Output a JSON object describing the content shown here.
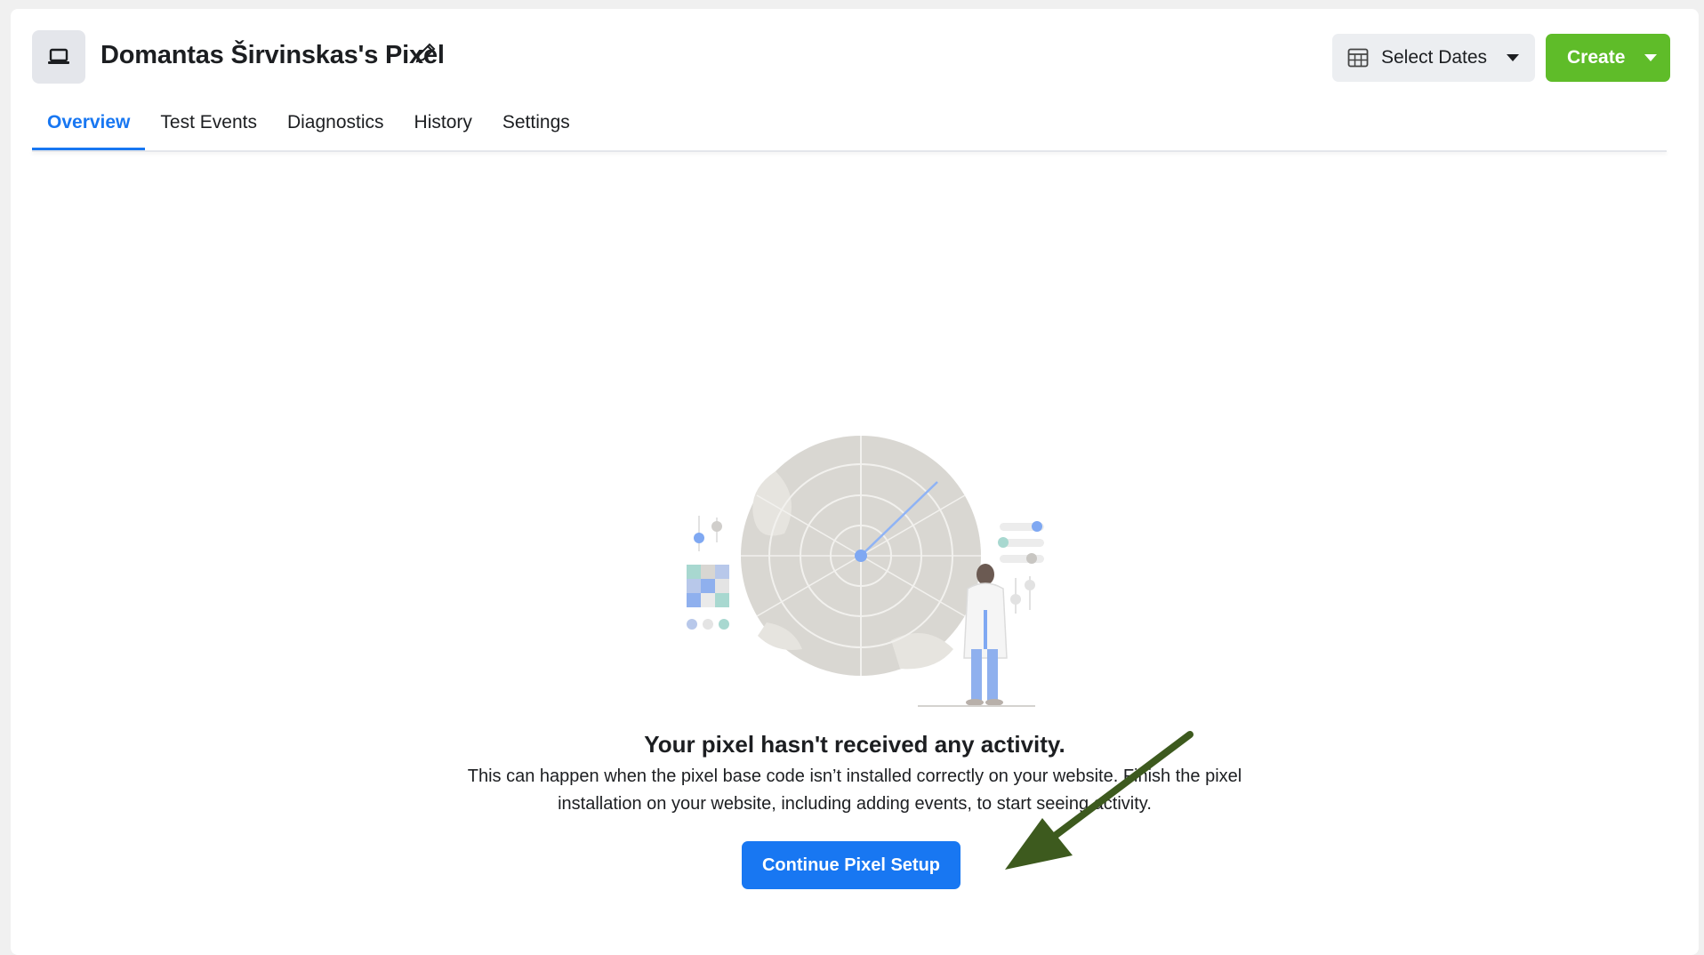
{
  "header": {
    "title": "Domantas Širvinskas's Pixel",
    "select_dates_label": "Select Dates",
    "create_label": "Create"
  },
  "tabs": [
    {
      "label": "Overview",
      "active": true
    },
    {
      "label": "Test Events",
      "active": false
    },
    {
      "label": "Diagnostics",
      "active": false
    },
    {
      "label": "History",
      "active": false
    },
    {
      "label": "Settings",
      "active": false
    }
  ],
  "empty_state": {
    "title": "Your pixel hasn't received any activity.",
    "description": "This can happen when the pixel base code isn’t installed correctly on your website. Finish the pixel installation on your website, including adding events, to start seeing activity.",
    "cta_label": "Continue Pixel Setup"
  },
  "colors": {
    "accent": "#1877f2",
    "create_green": "#5fbc29",
    "annotation_arrow": "#3d5a1e"
  },
  "icons": [
    "laptop-icon",
    "pencil-icon",
    "calendar-table-icon",
    "radar-illustration"
  ]
}
